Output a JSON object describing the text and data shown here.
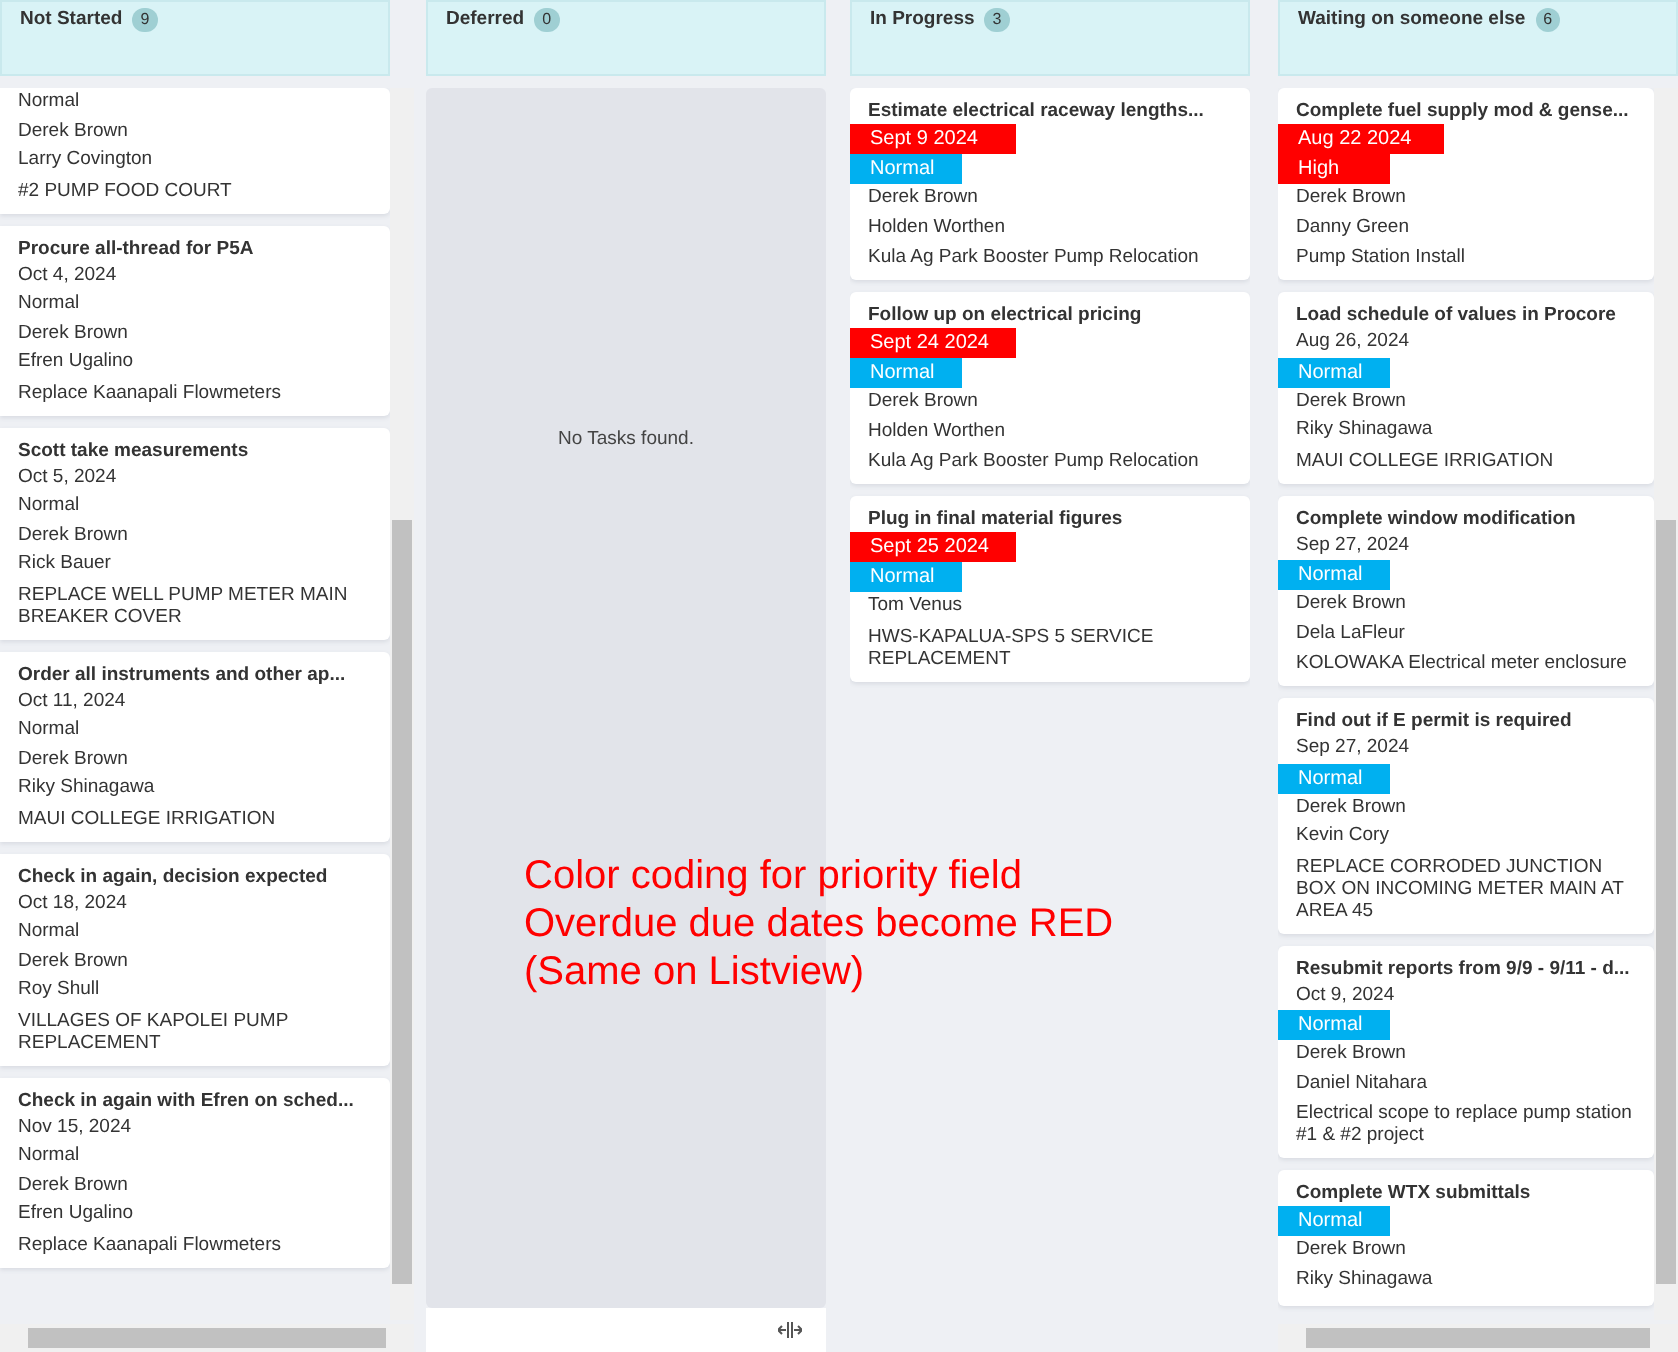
{
  "columns": [
    {
      "title": "Not Started",
      "count": "9",
      "kind": "scrollable",
      "cards": [
        {
          "priority": "Normal",
          "owner": "Derek Brown",
          "assignee": "Larry Covington",
          "project": "#2 PUMP FOOD COURT"
        },
        {
          "title": "Procure all-thread for P5A",
          "date": "Oct 4, 2024",
          "priority": "Normal",
          "owner": "Derek Brown",
          "assignee": "Efren Ugalino",
          "project": "Replace Kaanapali Flowmeters"
        },
        {
          "title": "Scott take measurements",
          "date": "Oct 5, 2024",
          "priority": "Normal",
          "owner": "Derek Brown",
          "assignee": "Rick Bauer",
          "project": "REPLACE WELL PUMP METER MAIN BREAKER COVER"
        },
        {
          "title": "Order all instruments and other ap...",
          "date": "Oct 11, 2024",
          "priority": "Normal",
          "owner": "Derek Brown",
          "assignee": "Riky Shinagawa",
          "project": "MAUI COLLEGE IRRIGATION"
        },
        {
          "title": "Check in again, decision expected",
          "date": "Oct 18, 2024",
          "priority": "Normal",
          "owner": "Derek Brown",
          "assignee": "Roy Shull",
          "project": "VILLAGES OF KAPOLEI PUMP REPLACEMENT"
        },
        {
          "title": "Check in again with Efren on sched...",
          "date": "Nov 15, 2024",
          "priority": "Normal",
          "owner": "Derek Brown",
          "assignee": "Efren Ugalino",
          "project": "Replace Kaanapali Flowmeters"
        }
      ]
    },
    {
      "title": "Deferred",
      "count": "0",
      "kind": "empty",
      "empty_message": "No Tasks found."
    },
    {
      "title": "In Progress",
      "count": "3",
      "kind": "plain",
      "cards": [
        {
          "title": "Estimate electrical raceway lengths...",
          "date_tag": {
            "label": "Sept 9 2024",
            "color": "#ff0000"
          },
          "priority_tag": {
            "label": "Normal",
            "color": "#00b0f0"
          },
          "owner": "Derek Brown",
          "assignee": "Holden Worthen",
          "project": "Kula Ag Park Booster Pump Relocation"
        },
        {
          "title": "Follow up on electrical pricing",
          "date_tag": {
            "label": "Sept 24 2024",
            "color": "#ff0000"
          },
          "priority_tag": {
            "label": "Normal",
            "color": "#00b0f0"
          },
          "owner": "Derek Brown",
          "assignee": "Holden Worthen",
          "project": "Kula Ag Park Booster Pump Relocation"
        },
        {
          "title": "Plug in final material figures",
          "date_tag": {
            "label": "Sept 25 2024",
            "color": "#ff0000"
          },
          "priority_tag": {
            "label": "Normal",
            "color": "#00b0f0"
          },
          "assignee": "Tom Venus",
          "project": "HWS-KAPALUA-SPS 5 SERVICE REPLACEMENT"
        }
      ]
    },
    {
      "title": "Waiting on someone else",
      "count": "6",
      "kind": "scrollable",
      "cards": [
        {
          "title": "Complete fuel supply mod & gense...",
          "date_tag": {
            "label": "Aug 22 2024",
            "color": "#ff0000"
          },
          "priority_tag": {
            "label": "High",
            "color": "#ff0000"
          },
          "owner": "Derek Brown",
          "assignee": "Danny Green",
          "project": "Pump Station Install"
        },
        {
          "title": "Load schedule of values in Procore",
          "date": "Aug 26, 2024",
          "priority_tag": {
            "label": "Normal",
            "color": "#00b0f0"
          },
          "owner": "Derek Brown",
          "assignee": "Riky Shinagawa",
          "project": "MAUI COLLEGE IRRIGATION"
        },
        {
          "title": "Complete window modification",
          "date": "Sep 27, 2024",
          "priority_tag": {
            "label": "Normal",
            "color": "#00b0f0"
          },
          "owner": "Derek Brown",
          "assignee": "Dela LaFleur",
          "project": "KOLOWAKA Electrical meter enclosure"
        },
        {
          "title": "Find out if E permit is required",
          "date": "Sep 27, 2024",
          "priority_tag": {
            "label": "Normal",
            "color": "#00b0f0"
          },
          "owner": "Derek Brown",
          "assignee": "Kevin Cory",
          "project": "REPLACE CORRODED JUNCTION BOX ON INCOMING METER MAIN AT AREA 45"
        },
        {
          "title": "Resubmit reports from 9/9 - 9/11 - d...",
          "date": "Oct 9, 2024",
          "priority_tag": {
            "label": "Normal",
            "color": "#00b0f0"
          },
          "owner": "Derek Brown",
          "assignee": "Daniel Nitahara",
          "project": "Electrical scope to replace pump station #1 & #2 project"
        },
        {
          "title": "Complete WTX submittals",
          "priority_tag": {
            "label": "Normal",
            "color": "#00b0f0"
          },
          "owner": "Derek Brown",
          "assignee": "Riky Shinagawa"
        }
      ]
    }
  ],
  "annotation": {
    "lines": [
      "Color coding for priority field",
      "Overdue due dates become RED",
      "(Same on Listview)"
    ]
  }
}
